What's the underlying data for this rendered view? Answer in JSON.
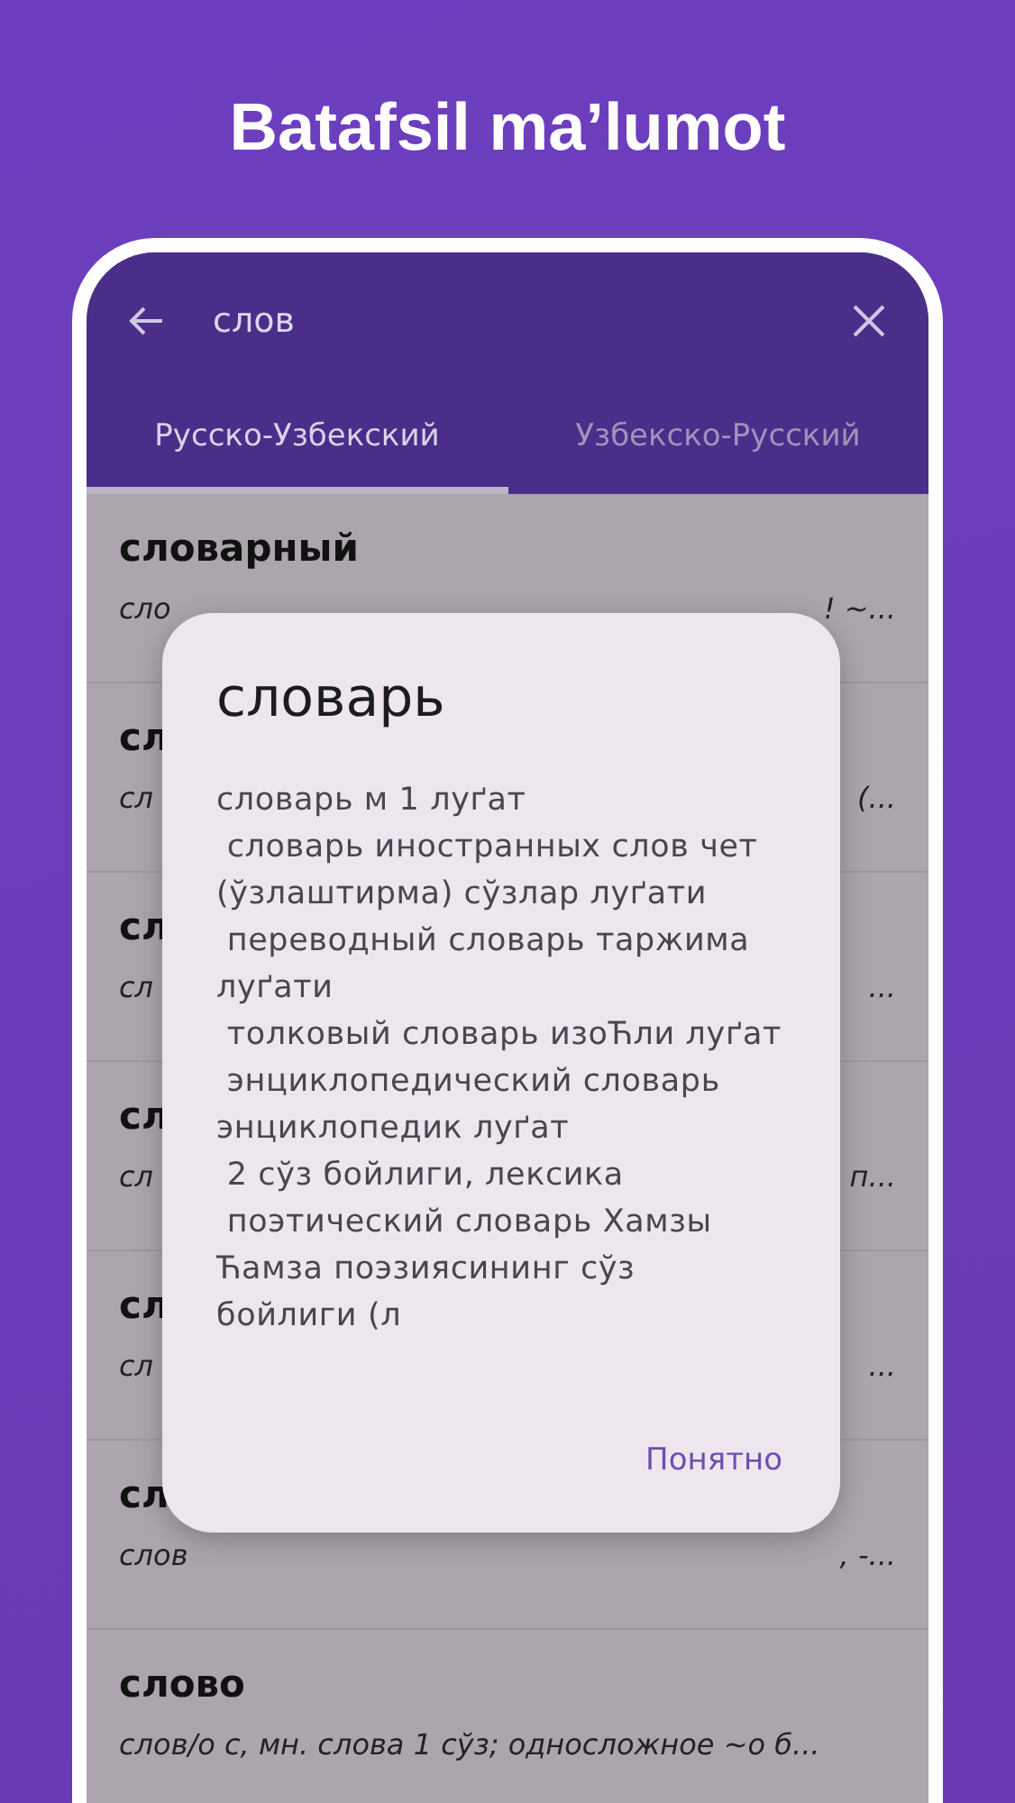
{
  "promo_title": "Batafsil ma’lumot",
  "search": {
    "value": "слов"
  },
  "tabs": [
    {
      "label": "Русско-Узбекский",
      "selected": true
    },
    {
      "label": "Узбекско-Русский",
      "selected": false
    }
  ],
  "entries": [
    {
      "headword": "словарный",
      "snippet_start": "сло",
      "snippet_end": "! ~..."
    },
    {
      "headword": "сл",
      "snippet_start": "сл",
      "snippet_end": "(..."
    },
    {
      "headword": "сл",
      "snippet_start": "сл",
      "snippet_end": "..."
    },
    {
      "headword": "сл",
      "snippet_start": "сл",
      "snippet_end": "п..."
    },
    {
      "headword": "сл",
      "snippet_start": "сл",
      "snippet_end": "..."
    },
    {
      "headword": "сл",
      "snippet_start": "слов",
      "snippet_end": ", -..."
    },
    {
      "headword": "слово",
      "snippet_start": "слов/о с, мн. слова 1 сўз; односложное ~о б..."
    }
  ],
  "dialog": {
    "title": "словарь",
    "body": "словарь м 1 луґат\n словарь иностранных слов чет (ўзлаштирма) сўзлар луґати\n переводный словарь таржима луґати\n толковый словарь изоЋли луґат\n энциклопедический словарь энциклопедик луґат\n 2 сўз бойлиги, лексика\n поэтический словарь Хамзы Ћамза поэзиясининг сўз бойлиги (л",
    "button": "Понятно"
  }
}
